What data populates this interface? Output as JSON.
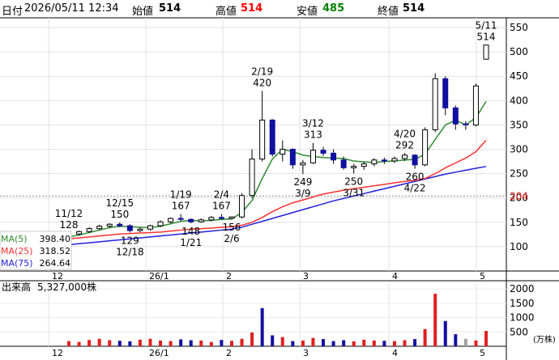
{
  "header": {
    "date_label": "日付",
    "date_value": "2026/05/11 12:34",
    "open_label": "始値",
    "open_value": "514",
    "high_label": "高値",
    "high_value": "514",
    "low_label": "安値",
    "low_value": "485",
    "close_label": "終値",
    "close_value": "514"
  },
  "colors": {
    "up": "#1a1aff",
    "down": "#1010a0",
    "ma5": "#2e8b2e",
    "ma25": "#ff3030",
    "ma75": "#2020e0",
    "high_value": "#ff0000",
    "low_value": "#008000",
    "ref_line_label": "#ff2020",
    "volume_up": "#e02020",
    "volume_down": "#1010a0",
    "volume_flat": "#a0a0a0"
  },
  "chart_data": [
    {
      "type": "candlestick",
      "y_axis_ticks": [
        "100",
        "150",
        "200",
        "250",
        "300",
        "350",
        "400",
        "450",
        "500",
        "550"
      ],
      "ylim": [
        50,
        570
      ],
      "reference_line": {
        "value": 204,
        "label": "204"
      },
      "x_axis_labels": [
        "12",
        "26/1",
        "2",
        "3",
        "4",
        "5"
      ],
      "x_month_fraction": [
        0.0,
        0.25,
        0.5,
        0.75,
        1.0
      ],
      "annotations": [
        {
          "date": "11/12",
          "value": "128"
        },
        {
          "date": "12/15",
          "value": "150"
        },
        {
          "date": "12/18",
          "value": "129"
        },
        {
          "date": "1/19",
          "value": "167"
        },
        {
          "date": "1/21",
          "value": "148"
        },
        {
          "date": "2/4",
          "value": "167"
        },
        {
          "date": "2/6",
          "value": "156"
        },
        {
          "date": "2/19",
          "value": "420"
        },
        {
          "date": "3/9",
          "value": "249"
        },
        {
          "date": "3/12",
          "value": "313"
        },
        {
          "date": "3/31",
          "value": "250"
        },
        {
          "date": "4/20",
          "value": "292"
        },
        {
          "date": "4/22",
          "value": "260"
        },
        {
          "date": "5/11",
          "value": "514"
        }
      ],
      "legend": [
        {
          "name": "MA(5)",
          "value": "398.40"
        },
        {
          "name": "MA(25)",
          "value": "318.52"
        },
        {
          "name": "MA(75)",
          "value": "264.64"
        }
      ],
      "candles": [
        {
          "date": "11/12",
          "o": 122,
          "h": 128,
          "l": 118,
          "c": 126
        },
        {
          "date": "11/19",
          "o": 126,
          "h": 133,
          "l": 123,
          "c": 131
        },
        {
          "date": "11/26",
          "o": 131,
          "h": 140,
          "l": 128,
          "c": 137
        },
        {
          "date": "12/3",
          "o": 137,
          "h": 145,
          "l": 134,
          "c": 142
        },
        {
          "date": "12/10",
          "o": 142,
          "h": 148,
          "l": 138,
          "c": 146
        },
        {
          "date": "12/15",
          "o": 146,
          "h": 150,
          "l": 140,
          "c": 143
        },
        {
          "date": "12/18",
          "o": 143,
          "h": 146,
          "l": 129,
          "c": 133
        },
        {
          "date": "12/24",
          "o": 133,
          "h": 139,
          "l": 130,
          "c": 136
        },
        {
          "date": "12/30",
          "o": 136,
          "h": 145,
          "l": 133,
          "c": 143
        },
        {
          "date": "1/7",
          "o": 143,
          "h": 154,
          "l": 140,
          "c": 151
        },
        {
          "date": "1/13",
          "o": 151,
          "h": 160,
          "l": 148,
          "c": 158
        },
        {
          "date": "1/19",
          "o": 158,
          "h": 167,
          "l": 153,
          "c": 156
        },
        {
          "date": "1/21",
          "o": 156,
          "h": 158,
          "l": 148,
          "c": 151
        },
        {
          "date": "1/27",
          "o": 151,
          "h": 158,
          "l": 149,
          "c": 155
        },
        {
          "date": "2/2",
          "o": 155,
          "h": 163,
          "l": 152,
          "c": 160
        },
        {
          "date": "2/4",
          "o": 160,
          "h": 167,
          "l": 156,
          "c": 158
        },
        {
          "date": "2/6",
          "o": 158,
          "h": 162,
          "l": 156,
          "c": 161
        },
        {
          "date": "2/12",
          "o": 161,
          "h": 210,
          "l": 158,
          "c": 205
        },
        {
          "date": "2/16",
          "o": 205,
          "h": 300,
          "l": 200,
          "c": 280
        },
        {
          "date": "2/19",
          "o": 280,
          "h": 420,
          "l": 275,
          "c": 360
        },
        {
          "date": "2/24",
          "o": 360,
          "h": 362,
          "l": 285,
          "c": 290
        },
        {
          "date": "3/2",
          "o": 290,
          "h": 318,
          "l": 275,
          "c": 300
        },
        {
          "date": "3/5",
          "o": 300,
          "h": 302,
          "l": 260,
          "c": 268
        },
        {
          "date": "3/9",
          "o": 268,
          "h": 278,
          "l": 249,
          "c": 272
        },
        {
          "date": "3/12",
          "o": 272,
          "h": 313,
          "l": 270,
          "c": 298
        },
        {
          "date": "3/17",
          "o": 298,
          "h": 305,
          "l": 286,
          "c": 292
        },
        {
          "date": "3/20",
          "o": 292,
          "h": 300,
          "l": 270,
          "c": 278
        },
        {
          "date": "3/25",
          "o": 278,
          "h": 285,
          "l": 258,
          "c": 262
        },
        {
          "date": "3/31",
          "o": 262,
          "h": 270,
          "l": 250,
          "c": 265
        },
        {
          "date": "4/3",
          "o": 265,
          "h": 275,
          "l": 258,
          "c": 270
        },
        {
          "date": "4/8",
          "o": 270,
          "h": 282,
          "l": 265,
          "c": 278
        },
        {
          "date": "4/13",
          "o": 278,
          "h": 283,
          "l": 270,
          "c": 276
        },
        {
          "date": "4/16",
          "o": 276,
          "h": 285,
          "l": 272,
          "c": 281
        },
        {
          "date": "4/20",
          "o": 281,
          "h": 292,
          "l": 276,
          "c": 288
        },
        {
          "date": "4/22",
          "o": 288,
          "h": 290,
          "l": 260,
          "c": 268
        },
        {
          "date": "4/24",
          "o": 268,
          "h": 345,
          "l": 265,
          "c": 340
        },
        {
          "date": "4/28",
          "o": 340,
          "h": 456,
          "l": 335,
          "c": 445
        },
        {
          "date": "4/30",
          "o": 445,
          "h": 450,
          "l": 370,
          "c": 385
        },
        {
          "date": "5/1",
          "o": 385,
          "h": 390,
          "l": 340,
          "c": 352
        },
        {
          "date": "5/7",
          "o": 352,
          "h": 358,
          "l": 340,
          "c": 350
        },
        {
          "date": "5/8",
          "o": 350,
          "h": 435,
          "l": 347,
          "c": 430
        },
        {
          "date": "5/11",
          "o": 485,
          "h": 514,
          "l": 485,
          "c": 514
        }
      ],
      "ma5": [
        120,
        124,
        129,
        134,
        139,
        142,
        141,
        140,
        139,
        142,
        147,
        152,
        154,
        153,
        154,
        156,
        157,
        170,
        195,
        240,
        280,
        300,
        295,
        288,
        285,
        283,
        282,
        281,
        276,
        274,
        273,
        275,
        276,
        278,
        279,
        290,
        320,
        350,
        360,
        350,
        365,
        398.4
      ],
      "ma25": [
        116,
        118,
        120,
        122,
        124,
        126,
        127,
        128,
        129,
        130,
        132,
        134,
        136,
        137,
        138,
        140,
        141,
        144,
        150,
        160,
        172,
        182,
        190,
        196,
        202,
        208,
        212,
        216,
        219,
        222,
        225,
        228,
        231,
        234,
        236,
        240,
        250,
        262,
        272,
        282,
        295,
        318.52
      ],
      "ma75": [
        104,
        106,
        108,
        110,
        112,
        114,
        116,
        118,
        120,
        122,
        124,
        126,
        128,
        130,
        132,
        134,
        136,
        140,
        146,
        152,
        158,
        164,
        170,
        176,
        182,
        188,
        194,
        199,
        204,
        209,
        214,
        219,
        224,
        229,
        234,
        239,
        244,
        249,
        253,
        257,
        261,
        264.64
      ]
    },
    {
      "type": "bar",
      "title": "出来高",
      "value_text": "5,327,000株",
      "unit": "(万株)",
      "y_axis_ticks": [
        "500",
        "1000",
        "1500",
        "2000"
      ],
      "ylim": [
        0,
        2200
      ],
      "x_axis_labels": [
        "12",
        "26/1",
        "2",
        "3",
        "4",
        "5"
      ],
      "values": [
        180,
        150,
        220,
        260,
        210,
        190,
        170,
        230,
        260,
        200,
        180,
        240,
        210,
        200,
        150,
        220,
        190,
        260,
        480,
        1330,
        380,
        320,
        180,
        200,
        290,
        250,
        180,
        210,
        170,
        230,
        200,
        190,
        180,
        210,
        250,
        600,
        1830,
        880,
        420,
        260,
        200,
        533
      ],
      "directions": [
        "u",
        "u",
        "u",
        "u",
        "u",
        "d",
        "d",
        "u",
        "u",
        "u",
        "u",
        "d",
        "d",
        "u",
        "u",
        "d",
        "u",
        "u",
        "u",
        "d",
        "d",
        "u",
        "d",
        "u",
        "u",
        "d",
        "d",
        "d",
        "u",
        "u",
        "u",
        "d",
        "u",
        "u",
        "d",
        "u",
        "u",
        "d",
        "d",
        "f",
        "u",
        "u"
      ]
    }
  ]
}
